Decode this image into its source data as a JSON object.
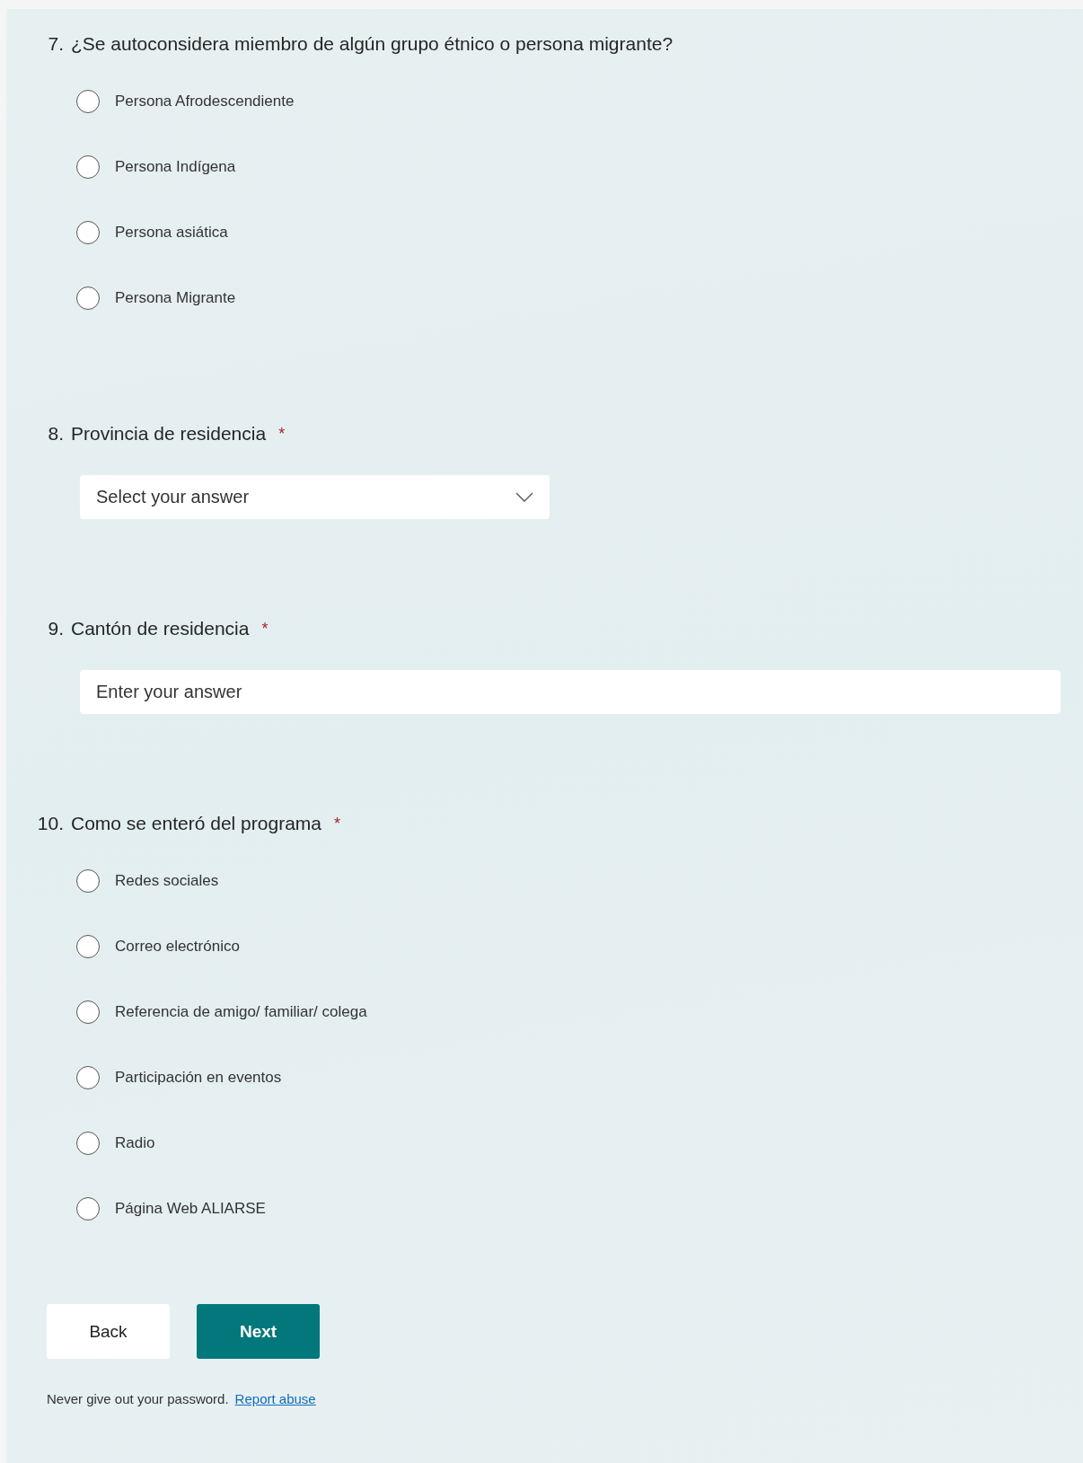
{
  "questions": [
    {
      "kind": "choice",
      "number": "7.",
      "title": "¿Se autoconsidera miembro de algún grupo étnico o persona migrante?",
      "options": [
        {
          "label": "Persona Afrodescendiente",
          "selected": false
        },
        {
          "label": "Persona Indígena",
          "selected": false
        },
        {
          "label": "Persona asiática",
          "selected": false
        },
        {
          "label": "Persona Migrante",
          "selected": false
        }
      ]
    },
    {
      "kind": "dropdown",
      "number": "8.",
      "title": "Provincia de residencia",
      "required_mark": "*",
      "placeholder": "Select your answer"
    },
    {
      "kind": "text",
      "number": "9.",
      "title": "Cantón de residencia",
      "required_mark": "*",
      "placeholder": "Enter your answer"
    },
    {
      "kind": "choice",
      "number": "10.",
      "title": "Como se enteró del programa",
      "required_mark": "*",
      "options": [
        {
          "label": "Redes sociales",
          "selected": false
        },
        {
          "label": "Correo electrónico",
          "selected": false
        },
        {
          "label": "Referencia de amigo/ familiar/ colega",
          "selected": false
        },
        {
          "label": "Participación en eventos",
          "selected": false
        },
        {
          "label": "Radio",
          "selected": false
        },
        {
          "label": "Página Web ALIARSE",
          "selected": false
        }
      ]
    }
  ],
  "buttons": [
    {
      "kind": "secondary",
      "label": "Back"
    },
    {
      "kind": "primary",
      "label": "Next"
    }
  ],
  "footer": {
    "note": "Never give out your password.",
    "link": "Report abuse"
  }
}
